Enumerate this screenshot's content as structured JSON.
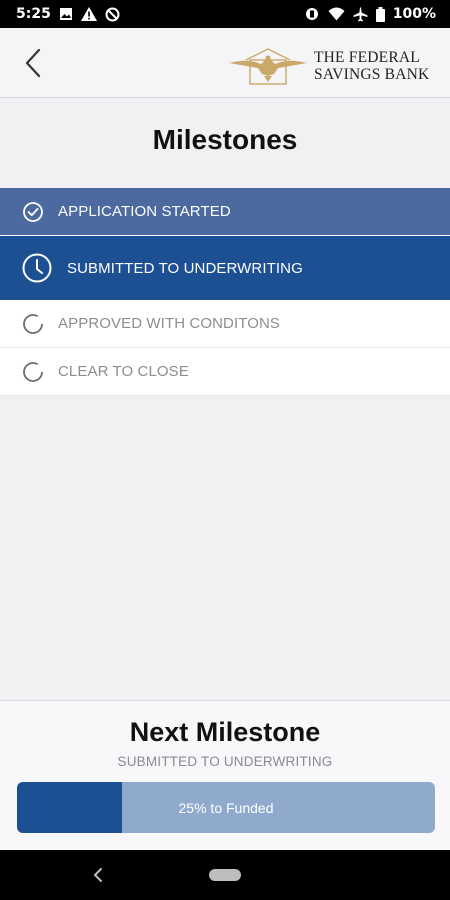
{
  "status_bar": {
    "time": "5:25",
    "battery": "100%",
    "left_icons": [
      "image-icon",
      "alert-icon",
      "sync-disabled-icon"
    ],
    "right_icons": [
      "vibrate-icon",
      "wifi-icon",
      "airplane-icon",
      "battery-icon"
    ]
  },
  "header": {
    "back_icon": "chevron-left-icon",
    "logo_line1": "THE FEDERAL",
    "logo_line2": "SAVINGS BANK"
  },
  "page": {
    "title": "Milestones"
  },
  "milestones": [
    {
      "label": "APPLICATION STARTED",
      "state": "done",
      "icon": "check-circle-icon"
    },
    {
      "label": "SUBMITTED TO UNDERWRITING",
      "state": "current",
      "icon": "clock-icon"
    },
    {
      "label": "APPROVED WITH CONDITONS",
      "state": "pending",
      "icon": "dashed-circle-icon"
    },
    {
      "label": "CLEAR TO CLOSE",
      "state": "pending",
      "icon": "dashed-circle-icon"
    }
  ],
  "next_milestone": {
    "title": "Next Milestone",
    "subtitle": "SUBMITTED TO UNDERWRITING",
    "progress_label": "25% to Funded",
    "progress_fraction": 0.25
  },
  "colors": {
    "done_row": "#4c6aa0",
    "current_row": "#1d4f93",
    "progress_track": "#8faacd",
    "progress_fill": "#1d4f93",
    "logo_gold": "#c9a86a"
  },
  "nav_bar": {
    "back_icon": "nav-back-icon",
    "home_icon": "home-pill-icon"
  }
}
